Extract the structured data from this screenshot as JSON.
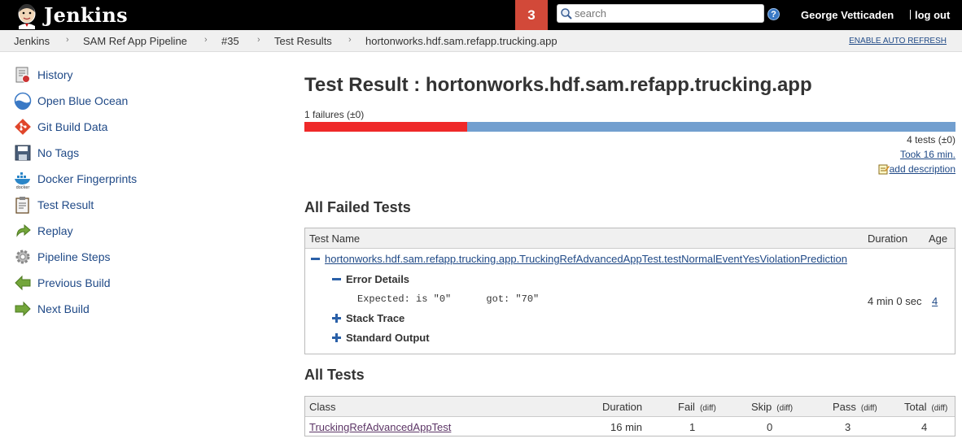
{
  "header": {
    "app_name": "Jenkins",
    "notification_count": "3",
    "search_placeholder": "search",
    "help_label": "?",
    "user_name": "George Vetticaden",
    "logout_label": "log out"
  },
  "breadcrumb": {
    "items": [
      "Jenkins",
      "SAM Ref App Pipeline",
      "#35",
      "Test Results",
      "hortonworks.hdf.sam.refapp.trucking.app"
    ],
    "separator": "›",
    "auto_refresh": "ENABLE AUTO REFRESH"
  },
  "sidebar": {
    "items": [
      {
        "label": "History",
        "icon": "history-icon"
      },
      {
        "label": "Open Blue Ocean",
        "icon": "blue-ocean-icon"
      },
      {
        "label": "Git Build Data",
        "icon": "git-icon"
      },
      {
        "label": "No Tags",
        "icon": "save-icon"
      },
      {
        "label": "Docker Fingerprints",
        "icon": "docker-icon"
      },
      {
        "label": "Test Result",
        "icon": "clipboard-icon"
      },
      {
        "label": "Replay",
        "icon": "replay-icon"
      },
      {
        "label": "Pipeline Steps",
        "icon": "gear-icon"
      },
      {
        "label": "Previous Build",
        "icon": "arrow-left-icon"
      },
      {
        "label": "Next Build",
        "icon": "arrow-right-icon"
      }
    ]
  },
  "main": {
    "title": "Test Result : hortonworks.hdf.sam.refapp.trucking.app",
    "failures_summary": "1 failures (±0)",
    "failed_count": 1,
    "total_count": 4,
    "tests_summary": "4 tests (±0)",
    "took": "Took 16 min.",
    "add_description": "add description",
    "colors": {
      "fail": "#ef2929",
      "pass": "#729fcf",
      "link": "#204a87"
    }
  },
  "failed_tests": {
    "heading": "All Failed Tests",
    "columns": [
      "Test Name",
      "Duration",
      "Age"
    ],
    "test_name": "hortonworks.hdf.sam.refapp.trucking.app.TruckingRefAdvancedAppTest.testNormalEventYesViolationPrediction",
    "error_details_label": "Error Details",
    "error_message": "Expected: is \"0\"      got: \"70\"",
    "stack_trace_label": "Stack Trace",
    "standard_output_label": "Standard Output",
    "duration": "4 min 0 sec",
    "age": "4"
  },
  "all_tests": {
    "heading": "All Tests",
    "columns": {
      "class": "Class",
      "duration": "Duration",
      "fail": "Fail",
      "skip": "Skip",
      "pass": "Pass",
      "total": "Total",
      "diff": "(diff)"
    },
    "rows": [
      {
        "class": "TruckingRefAdvancedAppTest",
        "duration": "16 min",
        "fail": "1",
        "skip": "0",
        "pass": "3",
        "total": "4"
      }
    ]
  }
}
